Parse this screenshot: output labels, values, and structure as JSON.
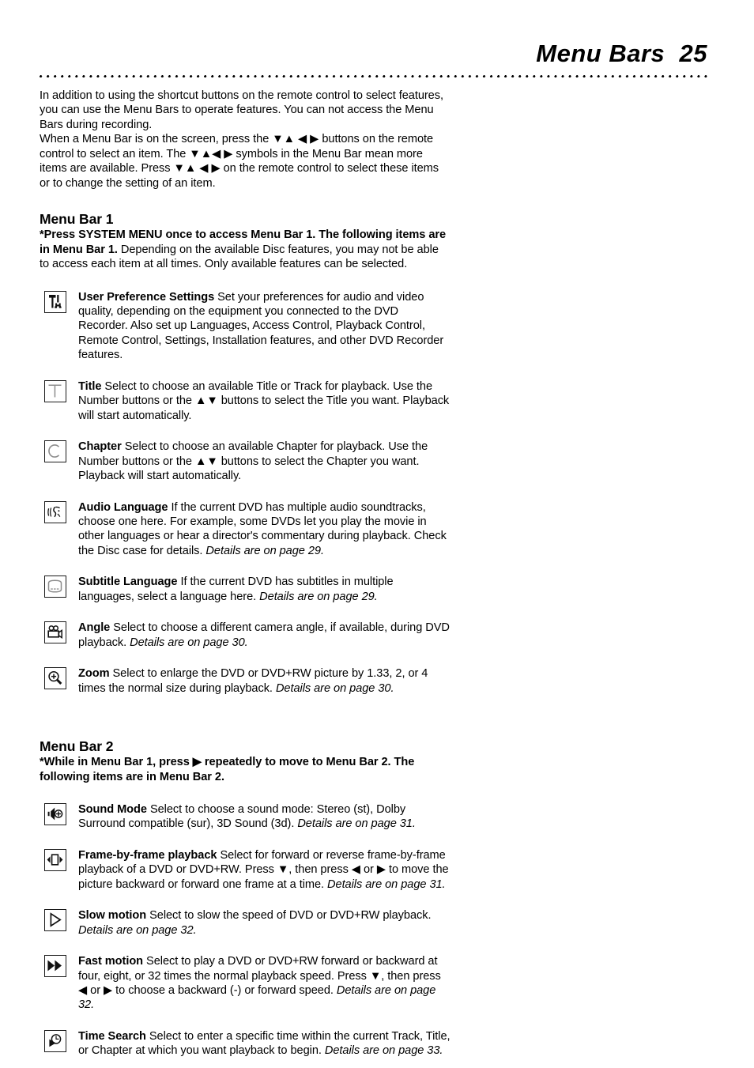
{
  "header": {
    "title": "Menu Bars  25",
    "page_number": "25",
    "title_text": "Menu Bars"
  },
  "intro": {
    "paragraph_1": "In addition to using the shortcut buttons on the remote control to select features, you can use the Menu Bars to operate features. You can not access the Menu Bars during recording.",
    "paragraph_2": "When a Menu Bar is on the screen, press the ▼▲ ◀ ▶ buttons on the remote control to select an item. The ▼▲◀ ▶ symbols in the Menu Bar mean more items are available. Press ▼▲ ◀ ▶ on the remote control to select these items or to change the setting of an item."
  },
  "menu_bar_1": {
    "heading": "Menu Bar 1",
    "lead_bold": "*Press SYSTEM MENU once to access Menu Bar 1. The following items are in Menu Bar 1.",
    "lead_rest": " Depending on the available Disc features, you may not be able to access each item at all times. Only available features can be selected.",
    "items": [
      {
        "icon": "tools-icon",
        "term": "User Preference Settings",
        "description": " Set your preferences for audio and video quality, depending on the equipment you connected to the DVD Recorder. Also set up Languages, Access Control, Playback Control, Remote Control, Settings, Installation features, and other DVD Recorder features.",
        "details": ""
      },
      {
        "icon": "title-t-icon",
        "term": "Title",
        "description": " Select to choose an available Title or Track for playback. Use the Number buttons or the ▲▼ buttons to select the Title you want. Playback will start automatically.",
        "details": ""
      },
      {
        "icon": "chapter-c-icon",
        "term": "Chapter",
        "description": " Select to choose an available Chapter for playback. Use the Number buttons or the ▲▼ buttons to select the Chapter you want. Playback will start automatically.",
        "details": ""
      },
      {
        "icon": "audio-language-icon",
        "term": "Audio Language",
        "description": " If the current DVD has multiple audio soundtracks, choose one here. For example, some DVDs let you play the movie in other languages or hear a director's commentary during playback. Check the Disc case for details. ",
        "details": "Details are on page 29."
      },
      {
        "icon": "subtitle-screen-icon",
        "term": "Subtitle Language",
        "description": " If the current DVD has subtitles in multiple languages, select a language here. ",
        "details": "Details are on page 29."
      },
      {
        "icon": "camera-angle-icon",
        "term": "Angle",
        "description": " Select to choose a different camera angle, if available, during DVD playback. ",
        "details": "Details are on page 30."
      },
      {
        "icon": "zoom-magnifier-icon",
        "term": "Zoom",
        "description": " Select to enlarge the DVD or DVD+RW picture by 1.33, 2, or 4 times the normal size during playback. ",
        "details": "Details are on page 30."
      }
    ]
  },
  "menu_bar_2": {
    "heading": "Menu Bar 2",
    "lead_bold": "*While in Menu Bar 1, press ▶ repeatedly to move to Menu Bar 2. The following items are in Menu Bar 2.",
    "items": [
      {
        "icon": "speaker-sound-icon",
        "term": "Sound Mode",
        "description": " Select to choose a sound mode: Stereo (st), Dolby Surround compatible (sur), 3D Sound (3d). ",
        "details": "Details are on page 31."
      },
      {
        "icon": "frame-by-frame-icon",
        "term": "Frame-by-frame playback",
        "description": " Select for forward or reverse frame-by-frame playback of a DVD or DVD+RW. Press ▼, then press ◀ or ▶ to move the picture backward or forward one frame at a time. ",
        "details": "Details are on page 31."
      },
      {
        "icon": "slow-motion-play-icon",
        "term": "Slow motion",
        "description": " Select to slow the speed of DVD or DVD+RW playback. ",
        "details": "Details are on page 32."
      },
      {
        "icon": "fast-motion-icon",
        "term": "Fast motion",
        "description": " Select to play a DVD or DVD+RW forward or backward at four, eight, or 32 times the normal playback speed. Press ▼, then press ◀ or ▶ to choose a backward (-) or forward speed. ",
        "details": "Details are on page 32."
      },
      {
        "icon": "time-search-clock-icon",
        "term": "Time Search",
        "description": " Select to enter a specific time within the current Track, Title, or Chapter at which you want playback to begin. ",
        "details": "Details are on page 33."
      }
    ]
  },
  "colors": {
    "text": "#000000",
    "icon_outline": "#1a1a1a",
    "icon_gray": "#8c8c8c"
  }
}
